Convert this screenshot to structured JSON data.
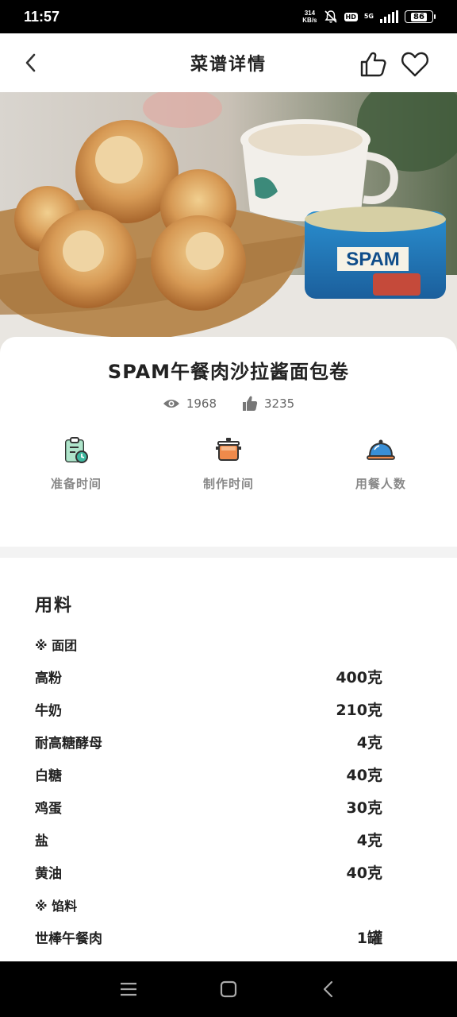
{
  "status_bar": {
    "time": "11:57",
    "net_speed_value": "314",
    "net_speed_unit": "KB/s",
    "hd": "HD",
    "network": "5G",
    "battery": "86"
  },
  "header": {
    "title": "菜谱详情"
  },
  "recipe": {
    "title": "SPAM午餐肉沙拉酱面包卷",
    "views": "1968",
    "likes": "3235"
  },
  "info": [
    {
      "label": "准备时间",
      "icon": "clipboard-clock-icon"
    },
    {
      "label": "制作时间",
      "icon": "pot-icon"
    },
    {
      "label": "用餐人数",
      "icon": "serving-dome-icon"
    }
  ],
  "ingredients": {
    "title": "用料",
    "groups": [
      {
        "name": "※  面团",
        "items": [
          {
            "name": "高粉",
            "amount": "400克"
          },
          {
            "name": "牛奶",
            "amount": "210克"
          },
          {
            "name": "耐高糖酵母",
            "amount": "4克"
          },
          {
            "name": "白糖",
            "amount": "40克"
          },
          {
            "name": "鸡蛋",
            "amount": "30克"
          },
          {
            "name": "盐",
            "amount": "4克"
          },
          {
            "name": "黄油",
            "amount": "40克"
          }
        ]
      },
      {
        "name": "※  馅料",
        "items": [
          {
            "name": "世棒午餐肉",
            "amount": "1罐"
          }
        ]
      }
    ]
  },
  "colors": {
    "accent_teal": "#3fb8a0",
    "accent_orange": "#f08a4b",
    "accent_blue": "#3a8fd6"
  }
}
